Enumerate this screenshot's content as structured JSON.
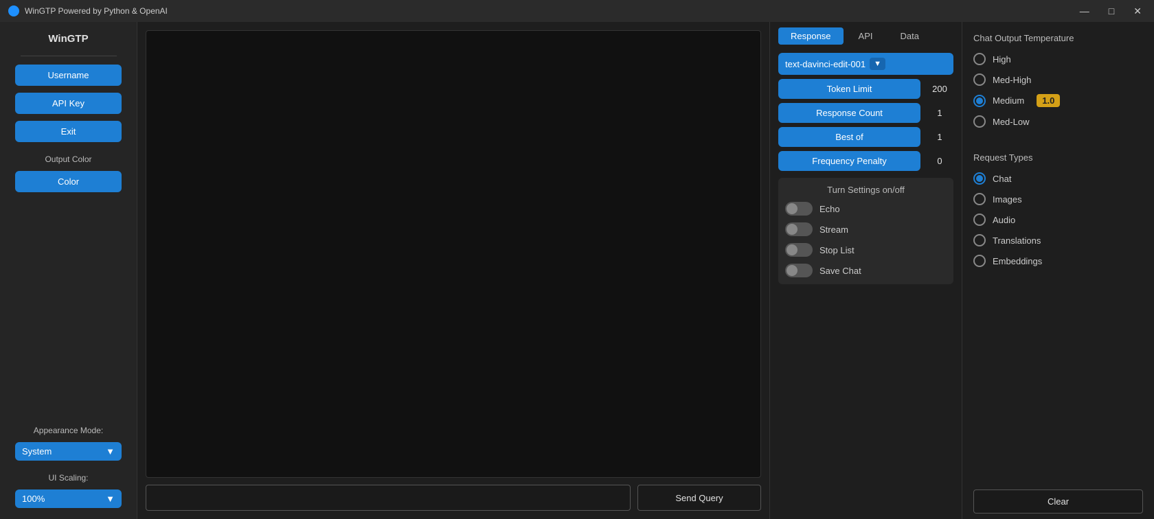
{
  "titlebar": {
    "title": "WinGTP Powered by Python & OpenAI",
    "minimize": "—",
    "maximize": "□",
    "close": "✕"
  },
  "sidebar": {
    "title": "WinGTP",
    "username_label": "Username",
    "api_key_label": "API Key",
    "exit_label": "Exit",
    "output_color_section": "Output Color",
    "color_label": "Color",
    "appearance_mode_section": "Appearance Mode:",
    "appearance_mode_value": "System",
    "ui_scaling_section": "UI Scaling:",
    "ui_scaling_value": "100%"
  },
  "tabs": {
    "response": "Response",
    "api": "API",
    "data": "Data"
  },
  "settings": {
    "model": "text-davinci-edit-001",
    "token_limit_label": "Token Limit",
    "token_limit_value": "200",
    "response_count_label": "Response Count",
    "response_count_value": "1",
    "best_of_label": "Best of",
    "best_of_value": "1",
    "frequency_penalty_label": "Frequency Penalty",
    "frequency_penalty_value": "0"
  },
  "toggles": {
    "section_title": "Turn Settings on/off",
    "echo_label": "Echo",
    "stream_label": "Stream",
    "stop_list_label": "Stop List",
    "save_chat_label": "Save Chat"
  },
  "temperature": {
    "section_title": "Chat Output Temperature",
    "high_label": "High",
    "med_high_label": "Med-High",
    "medium_label": "Medium",
    "medium_value": "1.0",
    "med_low_label": "Med-Low"
  },
  "request_types": {
    "section_title": "Request Types",
    "chat_label": "Chat",
    "images_label": "Images",
    "audio_label": "Audio",
    "translations_label": "Translations",
    "embeddings_label": "Embeddings"
  },
  "bottom": {
    "send_query": "Send Query",
    "clear": "Clear"
  }
}
